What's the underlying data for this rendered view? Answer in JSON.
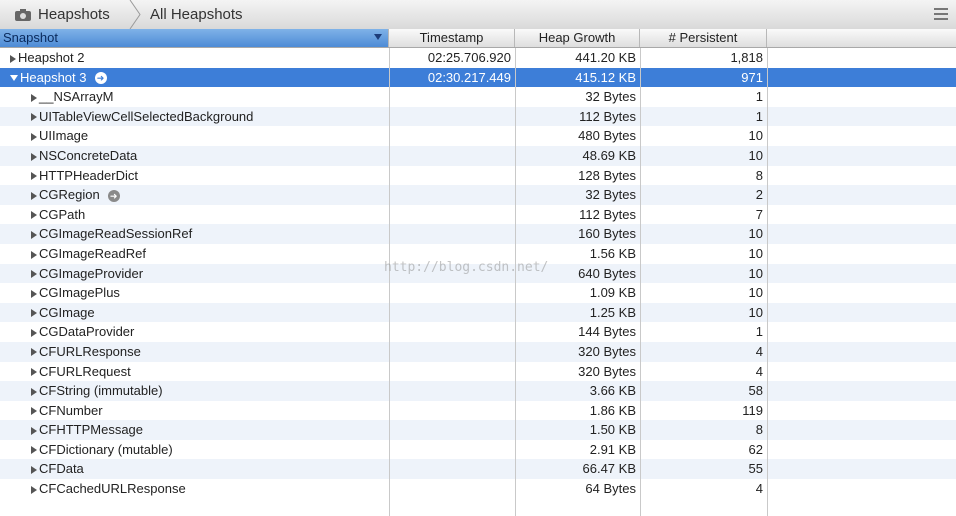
{
  "toolbar": {
    "breadcrumb_1": "Heapshots",
    "breadcrumb_2": "All Heapshots"
  },
  "columns": {
    "snapshot": "Snapshot",
    "timestamp": "Timestamp",
    "heap_growth": "Heap Growth",
    "persistent": "# Persistent"
  },
  "rows": [
    {
      "name": "Heapshot 2",
      "timestamp": "02:25.706.920",
      "growth": "441.20 KB",
      "persistent": "1,818"
    },
    {
      "name": "Heapshot 3",
      "timestamp": "02:30.217.449",
      "growth": "415.12 KB",
      "persistent": "971"
    },
    {
      "name": "__NSArrayM",
      "timestamp": "",
      "growth": "32 Bytes",
      "persistent": "1"
    },
    {
      "name": "UITableViewCellSelectedBackground",
      "timestamp": "",
      "growth": "112 Bytes",
      "persistent": "1"
    },
    {
      "name": "UIImage",
      "timestamp": "",
      "growth": "480 Bytes",
      "persistent": "10"
    },
    {
      "name": "NSConcreteData",
      "timestamp": "",
      "growth": "48.69 KB",
      "persistent": "10"
    },
    {
      "name": "HTTPHeaderDict",
      "timestamp": "",
      "growth": "128 Bytes",
      "persistent": "8"
    },
    {
      "name": "CGRegion",
      "timestamp": "",
      "growth": "32 Bytes",
      "persistent": "2"
    },
    {
      "name": "CGPath",
      "timestamp": "",
      "growth": "112 Bytes",
      "persistent": "7"
    },
    {
      "name": "CGImageReadSessionRef",
      "timestamp": "",
      "growth": "160 Bytes",
      "persistent": "10"
    },
    {
      "name": "CGImageReadRef",
      "timestamp": "",
      "growth": "1.56 KB",
      "persistent": "10"
    },
    {
      "name": "CGImageProvider",
      "timestamp": "",
      "growth": "640 Bytes",
      "persistent": "10"
    },
    {
      "name": "CGImagePlus",
      "timestamp": "",
      "growth": "1.09 KB",
      "persistent": "10"
    },
    {
      "name": "CGImage",
      "timestamp": "",
      "growth": "1.25 KB",
      "persistent": "10"
    },
    {
      "name": "CGDataProvider",
      "timestamp": "",
      "growth": "144 Bytes",
      "persistent": "1"
    },
    {
      "name": "CFURLResponse",
      "timestamp": "",
      "growth": "320 Bytes",
      "persistent": "4"
    },
    {
      "name": "CFURLRequest",
      "timestamp": "",
      "growth": "320 Bytes",
      "persistent": "4"
    },
    {
      "name": "CFString (immutable)",
      "timestamp": "",
      "growth": "3.66 KB",
      "persistent": "58"
    },
    {
      "name": "CFNumber",
      "timestamp": "",
      "growth": "1.86 KB",
      "persistent": "119"
    },
    {
      "name": "CFHTTPMessage",
      "timestamp": "",
      "growth": "1.50 KB",
      "persistent": "8"
    },
    {
      "name": "CFDictionary (mutable)",
      "timestamp": "",
      "growth": "2.91 KB",
      "persistent": "62"
    },
    {
      "name": "CFData",
      "timestamp": "",
      "growth": "66.47 KB",
      "persistent": "55"
    },
    {
      "name": "CFCachedURLResponse",
      "timestamp": "",
      "growth": "64 Bytes",
      "persistent": "4"
    }
  ],
  "watermark": "http://blog.csdn.net/"
}
